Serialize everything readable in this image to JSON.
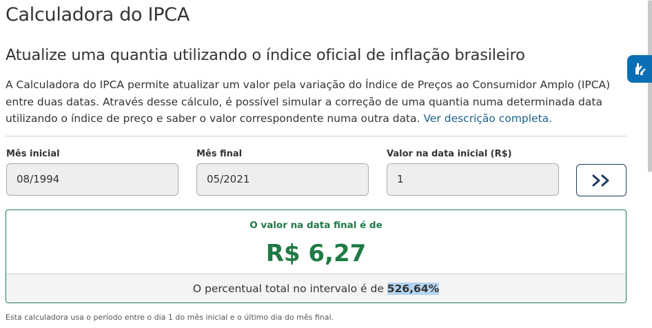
{
  "page": {
    "title": "Calculadora do IPCA",
    "subtitle": "Atualize uma quantia utilizando o índice oficial de inflação brasileiro",
    "description": "A Calculadora do IPCA permite atualizar um valor pela variação do Índice de Preços ao Consumidor Amplo (IPCA) entre duas datas. Através desse cálculo, é possível simular a correção de uma quantia numa determinada data utilizando o índice de preço e saber o valor correspondente numa outra data.",
    "description_link": "Ver descrição completa."
  },
  "form": {
    "start_month_label": "Mês inicial",
    "start_month_value": "08/1994",
    "end_month_label": "Mês final",
    "end_month_value": "05/2021",
    "initial_value_label": "Valor na data inicial (R$)",
    "initial_value": "1",
    "submit_icon": "double-chevron-right-icon"
  },
  "result": {
    "label": "O valor na data final é de",
    "value": "R$ 6,27",
    "percent_prefix": "O percentual total no intervalo é de",
    "percent_value": "526,64%"
  },
  "footnote": "Esta calculadora usa o período entre o dia 1 do mês inicial e o último dia do mês final.",
  "colors": {
    "accent_green": "#1f7a44",
    "link_blue": "#1a5f8a",
    "button_border": "#1b3a5c",
    "accessibility_widget": "#0a6eb4"
  },
  "widgets": {
    "accessibility_icon": "sign-language-hands-icon"
  }
}
